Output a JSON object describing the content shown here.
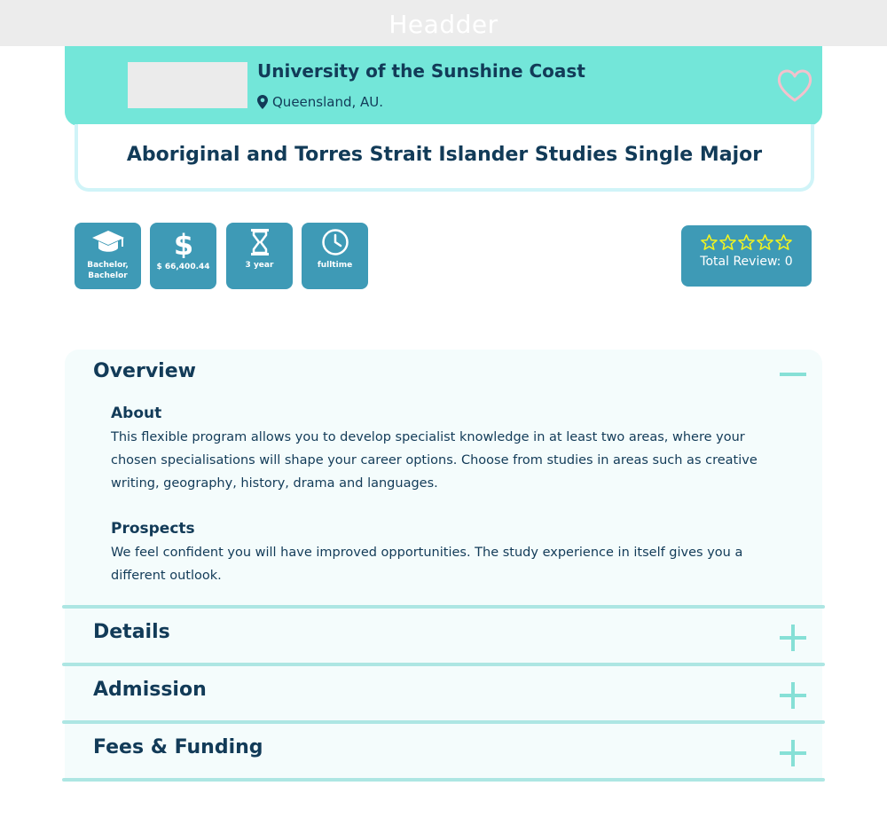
{
  "header": {
    "title": "Headder"
  },
  "university": {
    "name": "University of the Sunshine Coast",
    "location": "Queensland, AU."
  },
  "course": {
    "title": "Aboriginal and Torres Strait Islander Studies Single Major"
  },
  "info_tiles": [
    {
      "icon": "graduation-cap-icon",
      "label": "Bachelor, Bachelor"
    },
    {
      "icon": "dollar-icon",
      "label": "$ 66,400.44"
    },
    {
      "icon": "hourglass-icon",
      "label": "3 year"
    },
    {
      "icon": "clock-icon",
      "label": "fulltime"
    }
  ],
  "reviews": {
    "rating": 0,
    "max_rating": 5,
    "label": "Total Review: 0"
  },
  "accordion": {
    "overview": {
      "title": "Overview",
      "about_heading": "About",
      "about_text": "This flexible program allows you to develop specialist knowledge in at least two areas, where your chosen specialisations will shape your career options. Choose from studies in areas such as creative writing, geography, history, drama and languages.",
      "prospects_heading": "Prospects",
      "prospects_text": "We feel confident you will have improved opportunities. The study experience in itself gives you a different outlook."
    },
    "details": {
      "title": "Details"
    },
    "admission": {
      "title": "Admission"
    },
    "fees": {
      "title": "Fees & Funding"
    }
  },
  "colors": {
    "header_bg": "#ececec",
    "uni_card_bg": "#73e6d9",
    "tile_bg": "#3e9ab6",
    "text_dark": "#123b58",
    "accent_light": "#86e0d6",
    "star_yellow": "#f5f51e",
    "heart_pink": "#f3c1cc"
  }
}
